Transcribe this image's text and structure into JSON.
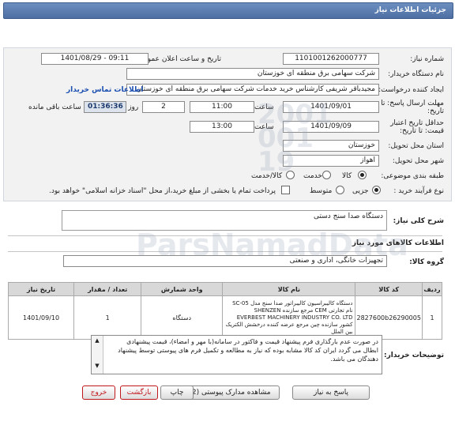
{
  "header": {
    "title": "جزئیات اطلاعات نیاز"
  },
  "form": {
    "need_number_label": "شماره نیاز:",
    "need_number": "1101001262000777",
    "announce_label": "تاریخ و ساعت اعلان عمومی:",
    "announce_value": "1401/08/29 - 09:11",
    "buyer_label": "نام دستگاه خریدار:",
    "buyer_value": "شرکت سهامی برق منطقه ای خوزستان",
    "creator_label": "ایجاد کننده درخواست:",
    "creator_value": "مجیدباقر شریفی کارشناس خرید خدمات شرکت سهامی برق منطقه ای خوزستان",
    "contact_link": "اطلاعات تماس خریدار",
    "deadline_label": "مهلت ارسال پاسخ: تا تاریخ:",
    "deadline_date": "1401/09/01",
    "time_label": "ساعت",
    "deadline_time": "11:00",
    "days_value": "2",
    "days_label": "روز و",
    "remaining_time": "01:36:36",
    "remaining_label": "ساعت باقی مانده",
    "validity_label": "حداقل تاریخ اعتبار قیمت: تا تاریخ:",
    "validity_date": "1401/09/09",
    "validity_time_label": "ساعت",
    "validity_time": "13:00",
    "province_label": "استان محل تحویل:",
    "province_value": "خوزستان",
    "city_label": "شهر محل تحویل:",
    "city_value": "اهواز",
    "category_label": "طبقه بندی موضوعی:",
    "category_options": [
      "کالا",
      "خدمت",
      "کالا/خدمت"
    ],
    "category_selected": "کالا",
    "process_label": "نوع فرآیند خرید :",
    "process_options": [
      "جزیی",
      "متوسط"
    ],
    "process_selected": "جزیی",
    "payment_text": "پرداخت تمام یا بخشی از مبلغ خرید،از محل \"اسناد خزانه اسلامی\" خواهد بود."
  },
  "summary": {
    "label": "شرح کلی نیاز:",
    "value": "دستگاه صدا سنج دستی"
  },
  "goods": {
    "section_title": "اطلاعات کالاهای مورد نیاز",
    "group_label": "گروه کالا:",
    "group_value": "تجهیزات خانگی، اداری و صنعتی",
    "columns": [
      "ردیف",
      "کد کالا",
      "نام کالا",
      "واحد شمارش",
      "تعداد / مقدار",
      "تاریخ نیاز"
    ],
    "rows": [
      {
        "row": "1",
        "code": "2827600b26290005",
        "name": "دستگاه کالیبراسیون کالیبراتور صدا سنج مدل SC-05 نام تجارتی CEM مرجع سازنده SHENZEN EVERBEST MACHINERY INDUSTRY CO. LTD کشور سازنده چین مرجع عرضه کننده درخشش الکتریک بین الملل",
        "unit": "دستگاه",
        "qty": "1",
        "date": "1401/09/10"
      }
    ]
  },
  "buyer_notes": {
    "label": "توضیحات خریدار:",
    "text": "در صورت عدم بارگذاری فرم پیشنهاد قیمت و فاکتور در سامانه(با مهر و امضاء)، قیمت پیشنهادی ابطال می گردد ایران کد کالا مشابه بوده که نیاز به مطالعه و تکمیل فرم های پیوستی توسط پیشنهاد دهندگان می باشد."
  },
  "buttons": {
    "reply": "پاسخ به نیاز",
    "attachments": "مشاهده مدارک پیوستی (2)",
    "print": "چاپ",
    "back": "بازگشت",
    "exit": "خروج"
  },
  "watermark": {
    "text": "ParsNamadData"
  },
  "colors": {
    "title_bar": "#4d6fa3",
    "link": "#1b4fb0",
    "exit_red": "#c0171b"
  }
}
